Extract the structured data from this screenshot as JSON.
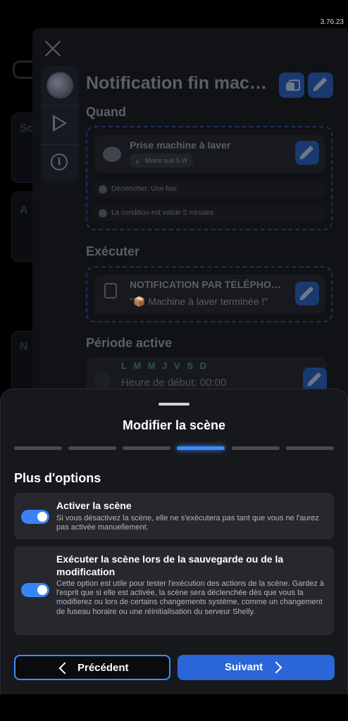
{
  "version": "3.76.23",
  "background": {
    "scene_title": "Notification fin machine à laver",
    "fragments": [
      "Sc",
      "A",
      "N"
    ],
    "when": {
      "label": "Quand",
      "trigger_title": "Prise machine à laver",
      "trigger_chip": "Moins que 5 W",
      "pill1": "Déclencher: Une fois",
      "pill2": "La condition est valide 5 minutes"
    },
    "execute": {
      "label": "Exécuter",
      "action_title": "NOTIFICATION PAR TÉLÉPHONE",
      "action_text": "\"📦 Machine à laver terminée !\""
    },
    "period": {
      "label": "Période active",
      "days": "L M M J V S D",
      "start": "Heure de début: 00:00"
    }
  },
  "sheet": {
    "title": "Modifier la scène",
    "steps_total": 6,
    "step_active": 4,
    "section_title": "Plus d'options",
    "options": [
      {
        "title": "Activer la scène",
        "description": "Si vous désactivez la scène, elle ne s'exécutera pas tant que vous ne l'aurez pas activée manuellement.",
        "enabled": true
      },
      {
        "title": "Exécuter la scène lors de la sauvegarde ou de la modification",
        "description": "Cette option est utile pour tester l'exécution des actions de la scène. Gardez à l'esprit que si elle est activée, la scène sera déclenchée dès que vous la modifierez ou lors de certains changements système, comme un changement de fuseau horaire ou une réinitialisation du serveur Shelly.",
        "enabled": true
      }
    ],
    "prev_label": "Précédent",
    "next_label": "Suivant"
  },
  "colors": {
    "accent": "#3f8cff",
    "toggle_on": "#3b82f6",
    "sheet_bg": "#17181c",
    "card_bg": "#26282d"
  }
}
